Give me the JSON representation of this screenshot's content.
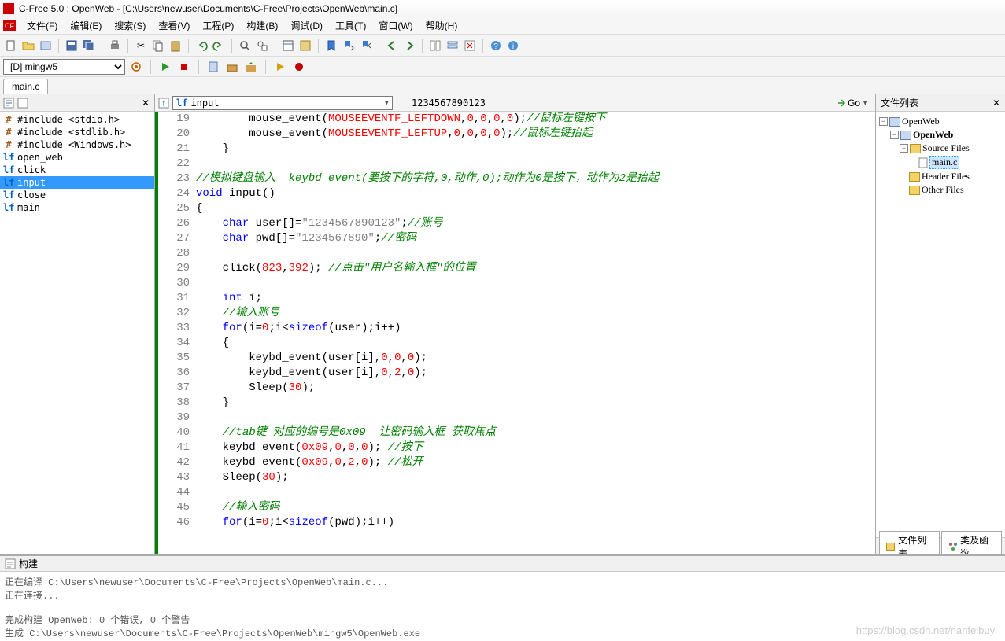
{
  "titlebar": {
    "text": "C-Free 5.0 : OpenWeb - [C:\\Users\\newuser\\Documents\\C-Free\\Projects\\OpenWeb\\main.c]"
  },
  "menu": {
    "file": "文件(F)",
    "edit": "编辑(E)",
    "search": "搜索(S)",
    "view": "查看(V)",
    "project": "工程(P)",
    "build": "构建(B)",
    "debug": "调试(D)",
    "tools": "工具(T)",
    "window": "窗口(W)",
    "help": "帮助(H)"
  },
  "config": {
    "selected": "[D] mingw5"
  },
  "tabs": {
    "file": "main.c"
  },
  "symbols": {
    "items": [
      {
        "icon": "#",
        "text": "#include <stdio.h>"
      },
      {
        "icon": "#",
        "text": "#include <stdlib.h>"
      },
      {
        "icon": "#",
        "text": "#include <Windows.h>"
      },
      {
        "icon": "f",
        "text": "open_web"
      },
      {
        "icon": "f",
        "text": "click"
      },
      {
        "icon": "f",
        "text": "input",
        "selected": true
      },
      {
        "icon": "f",
        "text": "close"
      },
      {
        "icon": "f",
        "text": "main"
      }
    ]
  },
  "funcbar": {
    "current": "input",
    "readout": "1234567890123",
    "go": "Go"
  },
  "filelist": {
    "title": "文件列表",
    "root": "OpenWeb",
    "project": "OpenWeb",
    "folders": {
      "source": "Source Files",
      "mainc": "main.c",
      "header": "Header Files",
      "other": "Other Files"
    }
  },
  "bottomtabs": {
    "filelist": "文件列表",
    "classes": "类及函数"
  },
  "buildpanel": {
    "title": "构建",
    "output": "正在编译 C:\\Users\\newuser\\Documents\\C-Free\\Projects\\OpenWeb\\main.c...\n正在连接...\n\n完成构建 OpenWeb: 0 个错误, 0 个警告\n生成 C:\\Users\\newuser\\Documents\\C-Free\\Projects\\OpenWeb\\mingw5\\OpenWeb.exe"
  },
  "watermark": "https://blog.csdn.net/nanfeibuyi",
  "code": {
    "lines": [
      {
        "n": 19,
        "html": "        mouse_event(<span class='const'>MOUSEEVENTF_LEFTDOWN</span>,<span class='num'>0</span>,<span class='num'>0</span>,<span class='num'>0</span>,<span class='num'>0</span>);<span class='cm'>//鼠标左键按下</span>"
      },
      {
        "n": 20,
        "html": "        mouse_event(<span class='const'>MOUSEEVENTF_LEFTUP</span>,<span class='num'>0</span>,<span class='num'>0</span>,<span class='num'>0</span>,<span class='num'>0</span>);<span class='cm'>//鼠标左键抬起</span>"
      },
      {
        "n": 21,
        "html": "    }"
      },
      {
        "n": 22,
        "html": ""
      },
      {
        "n": 23,
        "html": "<span class='cm'>//模拟键盘输入  keybd_event(要按下的字符,0,动作,0);动作为0是按下，动作为2是抬起</span>"
      },
      {
        "n": 24,
        "html": "<span class='kw'>void</span> input()"
      },
      {
        "n": 25,
        "html": "{"
      },
      {
        "n": 26,
        "html": "    <span class='kw'>char</span> user[]=<span class='str'>\"1234567890123\"</span>;<span class='cm'>//账号</span>"
      },
      {
        "n": 27,
        "html": "    <span class='kw'>char</span> pwd[]=<span class='str'>\"1234567890\"</span>;<span class='cm'>//密码</span>"
      },
      {
        "n": 28,
        "html": ""
      },
      {
        "n": 29,
        "html": "    click(<span class='num'>823</span>,<span class='num'>392</span>); <span class='cm'>//点击\"用户名输入框\"的位置</span>"
      },
      {
        "n": 30,
        "html": ""
      },
      {
        "n": 31,
        "html": "    <span class='kw'>int</span> i;"
      },
      {
        "n": 32,
        "html": "    <span class='cm'>//输入账号</span>"
      },
      {
        "n": 33,
        "html": "    <span class='kw'>for</span>(i=<span class='num'>0</span>;i&lt;<span class='kw'>sizeof</span>(user);i++)"
      },
      {
        "n": 34,
        "html": "    {"
      },
      {
        "n": 35,
        "html": "        keybd_event(user[i],<span class='num'>0</span>,<span class='num'>0</span>,<span class='num'>0</span>);"
      },
      {
        "n": 36,
        "html": "        keybd_event(user[i],<span class='num'>0</span>,<span class='num'>2</span>,<span class='num'>0</span>);"
      },
      {
        "n": 37,
        "html": "        Sleep(<span class='num'>30</span>);"
      },
      {
        "n": 38,
        "html": "    }"
      },
      {
        "n": 39,
        "html": ""
      },
      {
        "n": 40,
        "html": "    <span class='cm'>//tab键 对应的编号是0x09  让密码输入框 获取焦点</span>"
      },
      {
        "n": 41,
        "html": "    keybd_event(<span class='num'>0x09</span>,<span class='num'>0</span>,<span class='num'>0</span>,<span class='num'>0</span>); <span class='cm'>//按下</span>"
      },
      {
        "n": 42,
        "html": "    keybd_event(<span class='num'>0x09</span>,<span class='num'>0</span>,<span class='num'>2</span>,<span class='num'>0</span>); <span class='cm'>//松开</span>"
      },
      {
        "n": 43,
        "html": "    Sleep(<span class='num'>30</span>);"
      },
      {
        "n": 44,
        "html": ""
      },
      {
        "n": 45,
        "html": "    <span class='cm'>//输入密码</span>"
      },
      {
        "n": 46,
        "html": "    <span class='kw'>for</span>(i=<span class='num'>0</span>;i&lt;<span class='kw'>sizeof</span>(pwd);i++)"
      }
    ]
  }
}
